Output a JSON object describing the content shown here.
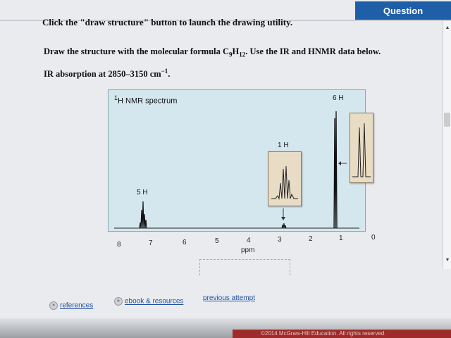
{
  "header": {
    "tab_label": "Question"
  },
  "instruction": "Click the \"draw structure\" button to launch the drawing utility.",
  "prompt": {
    "text_a": "Draw the structure with the molecular formula C",
    "sub1": "9",
    "text_b": "H",
    "sub2": "12",
    "text_c": ". Use the IR and HNMR data below."
  },
  "ir": {
    "text": "IR absorption at 2850–3150 cm",
    "sup": "−1",
    "end": "."
  },
  "spectrum": {
    "title_sup": "1",
    "title": "H NMR spectrum",
    "peak_labels": [
      "5 H",
      "1 H",
      "6 H"
    ],
    "x_label": "ppm",
    "ticks": [
      "8",
      "7",
      "6",
      "5",
      "4",
      "3",
      "2",
      "1",
      "0"
    ]
  },
  "chart_data": {
    "type": "line",
    "title": "1H NMR spectrum",
    "xlabel": "ppm",
    "xlim": [
      8,
      0
    ],
    "peaks": [
      {
        "shift": 7.2,
        "integration": "5 H"
      },
      {
        "shift": 2.9,
        "integration": "1 H"
      },
      {
        "shift": 1.2,
        "integration": "6 H"
      }
    ]
  },
  "links": {
    "references": "references",
    "ebook": "ebook & resources",
    "previous": "previous attempt"
  },
  "footer": "©2014 McGraw-Hill Education. All rights reserved."
}
